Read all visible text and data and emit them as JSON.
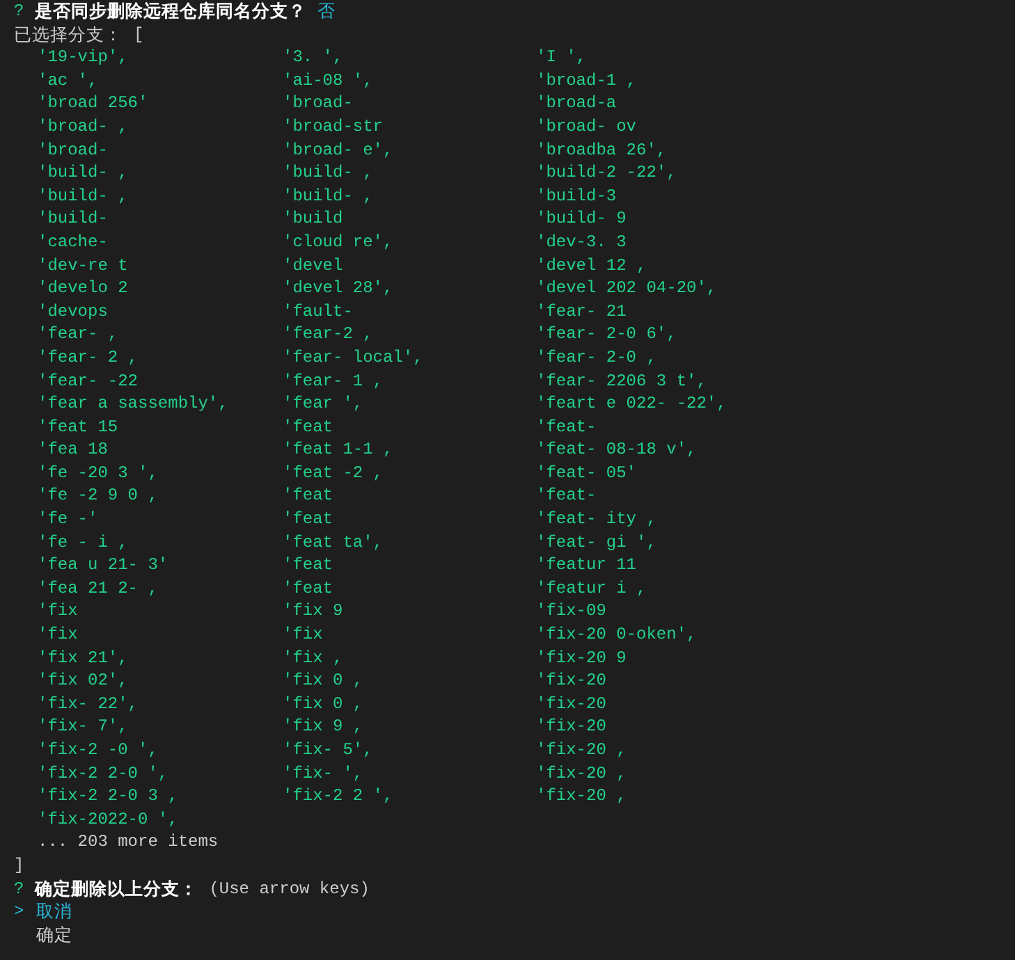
{
  "prompt": {
    "mark": "?",
    "question": "是否同步删除远程仓库同名分支？",
    "answer": "否"
  },
  "selected_label": "已选择分支：",
  "open_bracket": "[",
  "branch_rows": [
    [
      "'19-vip',",
      "'3. ',",
      "'I ',"
    ],
    [
      "'ac ',",
      "'ai-08 ',",
      "'broad-1 ,"
    ],
    [
      "'broad 256'",
      "'broad-",
      "'broad-a"
    ],
    [
      "'broad- ,",
      "'broad-str",
      "'broad- ov"
    ],
    [
      "'broad-",
      "'broad- e',",
      "'broadba 26',"
    ],
    [
      "'build- ,",
      "'build- ,",
      "'build-2 -22',"
    ],
    [
      "'build- ,",
      "'build- ,",
      "'build-3"
    ],
    [
      "'build-",
      "'build",
      "'build- 9"
    ],
    [
      "'cache-",
      "'cloud re',",
      "'dev-3. 3"
    ],
    [
      "'dev-re t",
      "'devel",
      "'devel 12 ,"
    ],
    [
      "'develo 2",
      "'devel 28',",
      "'devel 202 04-20',"
    ],
    [
      "'devops",
      "'fault-",
      "'fear- 21"
    ],
    [
      "'fear- ,",
      "'fear-2 ,",
      "'fear- 2-0 6',"
    ],
    [
      "'fear- 2 ,",
      "'fear- local',",
      "'fear- 2-0 ,"
    ],
    [
      "'fear- -22",
      "'fear- 1 ,",
      "'fear- 2206 3 t',"
    ],
    [
      "'fear a sassembly',",
      "'fear ',",
      "'feart e 022- -22',"
    ],
    [
      "'feat 15",
      "'feat",
      "'feat-"
    ],
    [
      "'fea 18",
      "'feat 1-1 ,",
      "'feat- 08-18 v',"
    ],
    [
      "'fe -20 3 ',",
      "'feat -2 ,",
      "'feat- 05'"
    ],
    [
      "'fe -2 9 0 ,",
      "'feat",
      "'feat-"
    ],
    [
      "'fe -'",
      "'feat",
      "'feat- ity ,"
    ],
    [
      "'fe - i ,",
      "'feat ta',",
      "'feat- gi ',"
    ],
    [
      "'fea u 21- 3'",
      "'feat",
      "'featur 11"
    ],
    [
      "'fea 21 2- ,",
      "'feat",
      "'featur i ,"
    ],
    [
      "'fix",
      "'fix 9",
      "'fix-09"
    ],
    [
      "'fix",
      "'fix",
      "'fix-20 0-oken',"
    ],
    [
      "'fix 21',",
      "'fix ,",
      "'fix-20 9"
    ],
    [
      "'fix 02',",
      "'fix 0 ,",
      "'fix-20"
    ],
    [
      "'fix- 22',",
      "'fix 0 ,",
      "'fix-20"
    ],
    [
      "'fix- 7',",
      "'fix 9 ,",
      "'fix-20"
    ],
    [
      "'fix-2 -0 ',",
      "'fix- 5',",
      "'fix-20 ,"
    ],
    [
      "'fix-2 2-0 ',",
      "'fix- ',",
      "'fix-20 ,"
    ],
    [
      "'fix-2 2-0 3 ,",
      "'fix-2 2 ',",
      "'fix-20 ,"
    ],
    [
      "'fix-2022-0 ',"
    ]
  ],
  "more_items": "... 203 more items",
  "close_bracket": "]",
  "confirm": {
    "mark": "?",
    "question": "确定删除以上分支：",
    "hint": "(Use arrow keys)"
  },
  "pointer": ">",
  "options": [
    {
      "label": "取消",
      "selected": true
    },
    {
      "label": "确定",
      "selected": false
    }
  ]
}
